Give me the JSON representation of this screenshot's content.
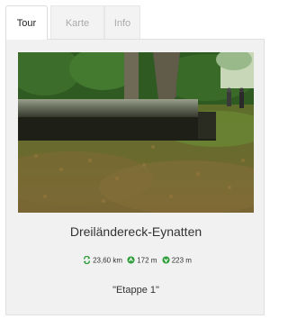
{
  "tabs": [
    {
      "label": "Tour",
      "active": true
    },
    {
      "label": "Karte",
      "active": false
    },
    {
      "label": "Info",
      "active": false
    }
  ],
  "tour": {
    "title": "Dreiländereck-Eynatten",
    "stats": {
      "distance": "23,60 km",
      "ascent": "172  m",
      "descent": "223 m"
    },
    "stage": "\"Etappe 1\""
  },
  "icons": {
    "distance": "loop-arrows-icon",
    "ascent": "arrow-up-circle-icon",
    "descent": "arrow-down-circle-icon"
  },
  "colors": {
    "accent_green": "#2e9e3b",
    "panel_bg": "#f1f1f1",
    "tab_inactive_text": "#aaaaaa"
  }
}
